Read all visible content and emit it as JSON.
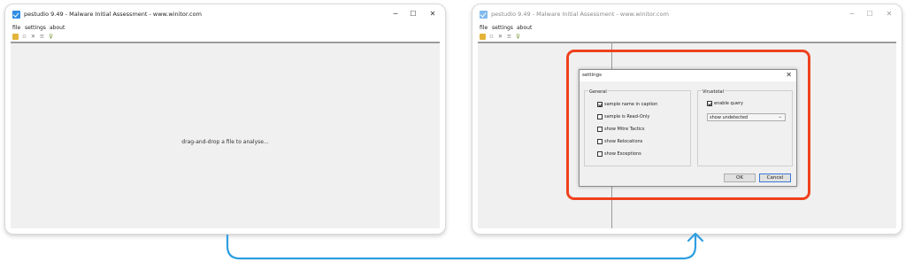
{
  "window": {
    "title": "pestudio 9.49 - Malware Initial Assessment - www.winitor.com",
    "controls": {
      "minimize": "─",
      "maximize": "☐",
      "close": "✕"
    }
  },
  "menu": {
    "file": "file",
    "settings": "settings",
    "about": "about"
  },
  "toolbar_icons": [
    "open-folder-icon",
    "save-icon",
    "close-file-icon",
    "list-icon",
    "key-icon"
  ],
  "left_panel": {
    "drop_hint": "drag-and-drop a file to analyse..."
  },
  "settings_dialog": {
    "title": "settings",
    "close": "✕",
    "general": {
      "label": "General",
      "options": [
        {
          "label": "sample name in caption",
          "checked": true
        },
        {
          "label": "sample is Read-Only",
          "checked": false
        },
        {
          "label": "show Mitre Tactics",
          "checked": false
        },
        {
          "label": "show Relocations",
          "checked": false
        },
        {
          "label": "show Exceptions",
          "checked": false
        }
      ]
    },
    "virustotal": {
      "label": "Virustotal",
      "enable_query": {
        "label": "enable query",
        "checked": true
      },
      "dropdown": {
        "selected": "show undetected",
        "arrow": "⌄"
      }
    },
    "buttons": {
      "ok": "OK",
      "cancel": "Cancel"
    }
  },
  "colors": {
    "highlight": "#f0411e",
    "arrow": "#2d9ee0",
    "accent": "#2f8de4"
  }
}
